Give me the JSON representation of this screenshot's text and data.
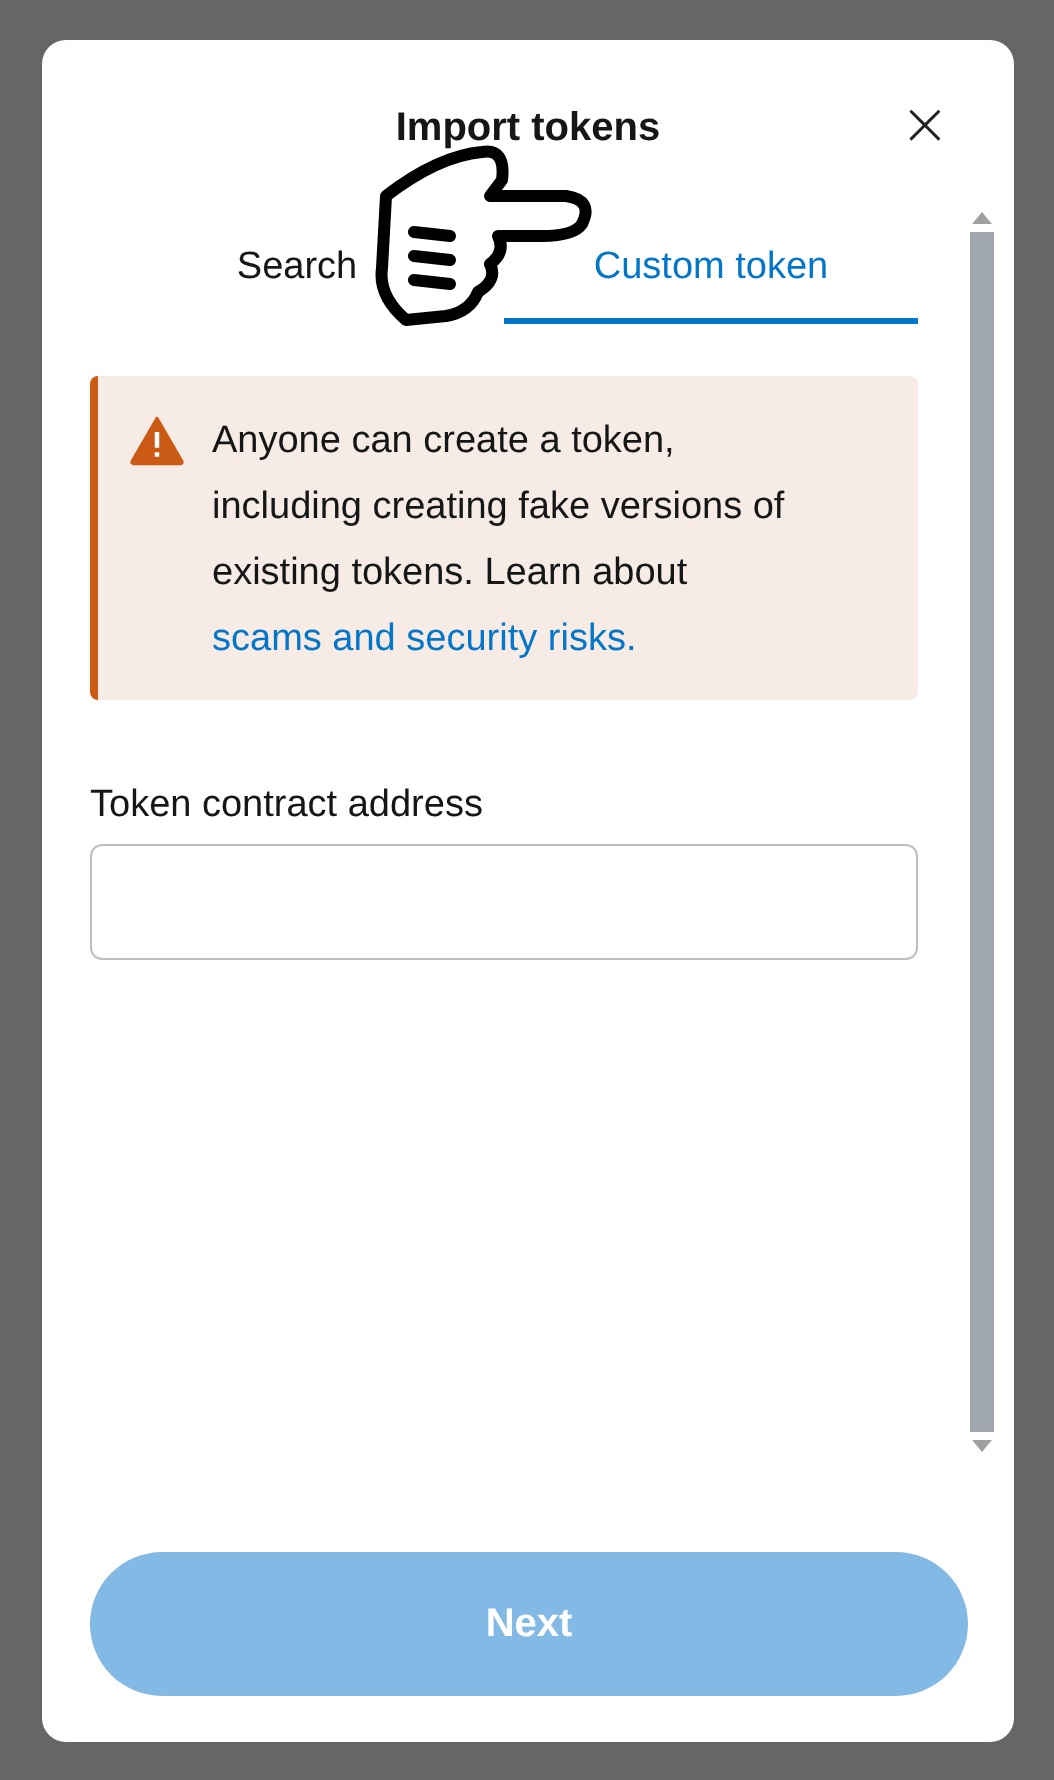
{
  "dialog": {
    "title": "Import tokens",
    "close": "×"
  },
  "tabs": [
    {
      "label": "Search",
      "selected": false
    },
    {
      "label": "Custom token",
      "selected": true
    }
  ],
  "alert": {
    "text": "Anyone can create a token, including creating fake versions of existing tokens. Learn about",
    "link": "scams and security risks."
  },
  "field": {
    "label": "Token contract address"
  },
  "next_button": {
    "label": "Next",
    "disabled": true
  }
}
